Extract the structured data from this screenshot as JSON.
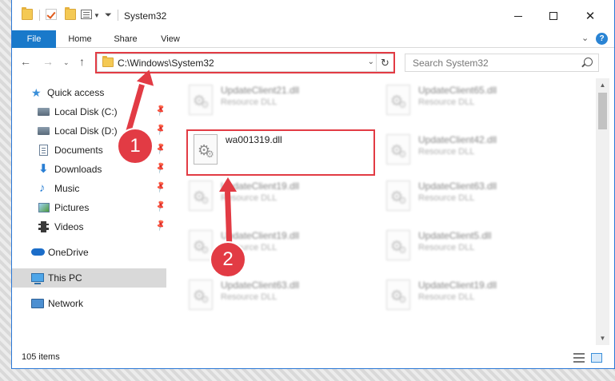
{
  "window": {
    "title": "System32"
  },
  "ribbon": {
    "tabs": [
      {
        "label": "File"
      },
      {
        "label": "Home"
      },
      {
        "label": "Share"
      },
      {
        "label": "View"
      }
    ]
  },
  "address": {
    "path": "C:\\Windows\\System32"
  },
  "search": {
    "placeholder": "Search System32"
  },
  "nav": {
    "quick_access": "Quick access",
    "items": [
      {
        "label": "Local Disk (C:)",
        "icon": "drive-icon"
      },
      {
        "label": "Local Disk (D:)",
        "icon": "drive-icon"
      },
      {
        "label": "Documents",
        "icon": "documents-icon"
      },
      {
        "label": "Downloads",
        "icon": "downloads-icon"
      },
      {
        "label": "Music",
        "icon": "music-icon"
      },
      {
        "label": "Pictures",
        "icon": "pictures-icon"
      },
      {
        "label": "Videos",
        "icon": "videos-icon"
      }
    ],
    "onedrive": "OneDrive",
    "this_pc": "This PC",
    "network": "Network"
  },
  "files": {
    "highlighted": {
      "name": "wa001319.dll"
    },
    "left_column": [
      {
        "name": "UpdateClient21.dll",
        "type": "Resource DLL"
      },
      {
        "name": "UpdateClient19.dll",
        "type": "Resource DLL"
      },
      {
        "name": "UpdateClient19.dll",
        "type": "Resource DLL"
      },
      {
        "name": "UpdateClient63.dll",
        "type": "Resource DLL"
      }
    ],
    "right_column": [
      {
        "name": "UpdateClient65.dll",
        "type": "Resource DLL"
      },
      {
        "name": "UpdateClient42.dll",
        "type": "Resource DLL"
      },
      {
        "name": "UpdateClient63.dll",
        "type": "Resource DLL"
      },
      {
        "name": "UpdateClient5.dll",
        "type": "Resource DLL"
      },
      {
        "name": "UpdateClient19.dll",
        "type": "Resource DLL"
      }
    ]
  },
  "status": {
    "item_count": "105 items"
  },
  "annotations": {
    "step1": "1",
    "step2": "2",
    "color": "#e23b44"
  }
}
